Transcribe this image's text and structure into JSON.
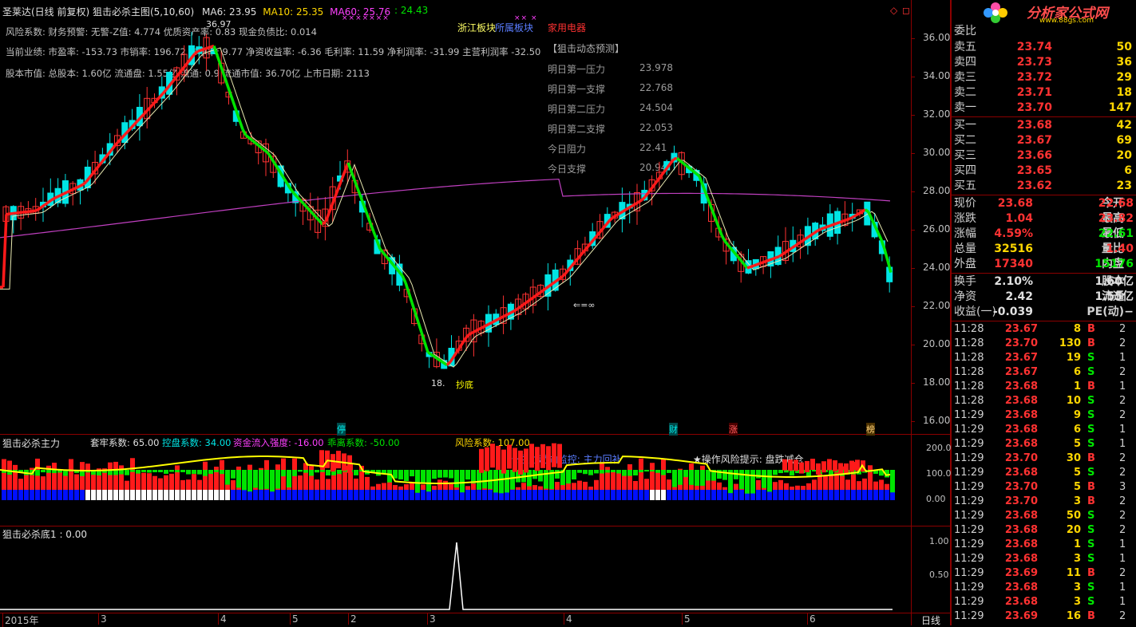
{
  "header": {
    "stock_title": "圣莱达(日线 前复权) 狙击必杀主图(5,10,60)",
    "ma6_label": "MA6: 23.95",
    "ma10_label": "MA10: 25.35",
    "ma60_label": "MA60: 25.76",
    "extra_value": ": 24.43",
    "marks": "×××××××",
    "marks2": "×× ×"
  },
  "info": {
    "line1": "风险系数: 财务预警: 无警-Z值: 4.774 优质资产率: 0.83 现金负债比: 0.014",
    "line2": "当前业绩: 市盈率: -153.73 市销率: 196.72 市净率: 9.77 净资收益率: -6.36 毛利率: 11.59 净利润率: -31.99 主营利润率 -32.50",
    "line3": "股本市值: 总股本: 1.60亿 流通盘: 1.55亿 流通: 0.9 流通市值: 36.70亿 上市日期: 2113"
  },
  "sectors": {
    "s1": "浙江板块",
    "s2": "所属板块",
    "s3": "家用电器"
  },
  "prediction": {
    "title": "【狙击动态预测】",
    "rows": [
      {
        "label": "明日第一压力",
        "value": "23.978"
      },
      {
        "label": "明日第一支撑",
        "value": "22.768"
      },
      {
        "label": "明日第二压力",
        "value": "24.504"
      },
      {
        "label": "明日第二支撑",
        "value": "22.053"
      },
      {
        "label": "今日阻力",
        "value": "22.41"
      },
      {
        "label": "今日支撑",
        "value": "20.94"
      }
    ]
  },
  "price_axis": [
    "36.00",
    "34.00",
    "32.00",
    "30.00",
    "28.00",
    "26.00",
    "24.00",
    "22.00",
    "20.00",
    "18.00",
    "16.00"
  ],
  "chart_annotations": {
    "high_label": "36.97",
    "low_label": "18.",
    "low_tag": "抄底",
    "ma_cross": "⇐=∞",
    "tag_ting": "停",
    "tag_cai": "财",
    "tag_zhang": "涨",
    "tag_bang": "榜"
  },
  "sub1": {
    "title": "狙击必杀主力",
    "jl": "套牢系数: 65.00",
    "kp": "控盘系数: 34.00",
    "zj": "资金流入强度: -16.00",
    "ql": "乖离系数: -50.00",
    "fx": "风险系数: 107.00",
    "monitor": "★主力动向监控: 主力回补",
    "tip": "★操作风险提示: 盘跌减仓",
    "axis": [
      "200.0",
      "100.0",
      "0.00"
    ]
  },
  "sub2": {
    "title": "狙击必杀底1 : 0.00",
    "axis": [
      "1.00",
      "0.50"
    ]
  },
  "time_axis": {
    "labels": [
      "2015年",
      "3",
      "4",
      "5",
      "2",
      "3",
      "4",
      "5",
      "6"
    ],
    "period": "日线"
  },
  "brand": {
    "name": "分析家公式网",
    "url": "www.88gs.com"
  },
  "order_book": {
    "header": "委比",
    "asks": [
      {
        "label": "卖五",
        "price": "23.74",
        "vol": "50"
      },
      {
        "label": "卖四",
        "price": "23.73",
        "vol": "36"
      },
      {
        "label": "卖三",
        "price": "23.72",
        "vol": "29"
      },
      {
        "label": "卖二",
        "price": "23.71",
        "vol": "18"
      },
      {
        "label": "卖一",
        "price": "23.70",
        "vol": "147"
      }
    ],
    "bids": [
      {
        "label": "买一",
        "price": "23.68",
        "vol": "42"
      },
      {
        "label": "买二",
        "price": "23.67",
        "vol": "69"
      },
      {
        "label": "买三",
        "price": "23.66",
        "vol": "20"
      },
      {
        "label": "买四",
        "price": "23.65",
        "vol": "6"
      },
      {
        "label": "买五",
        "price": "23.62",
        "vol": "23"
      }
    ]
  },
  "quote": [
    {
      "l1": "现价",
      "v1": "23.68",
      "l2": "今开",
      "v2": "22.68",
      "c1": "red",
      "c2": "red"
    },
    {
      "l1": "涨跌",
      "v1": "1.04",
      "l2": "最高",
      "v2": "23.82",
      "c1": "red",
      "c2": "red"
    },
    {
      "l1": "涨幅",
      "v1": "4.59%",
      "l2": "最低",
      "v2": "22.61",
      "c1": "red",
      "c2": "green"
    },
    {
      "l1": "总量",
      "v1": "32516",
      "l2": "量比",
      "v2": "1.40",
      "c1": "yellow",
      "c2": "red"
    },
    {
      "l1": "外盘",
      "v1": "17340",
      "l2": "内盘",
      "v2": "15176",
      "c1": "red",
      "c2": "green"
    }
  ],
  "quote2": [
    {
      "l1": "换手",
      "v1": "2.10%",
      "l2": "股本",
      "v2": "1.60亿"
    },
    {
      "l1": "净资",
      "v1": "2.42",
      "l2": "流通",
      "v2": "1.55亿"
    },
    {
      "l1": "收益(一)",
      "v1": "-0.039",
      "l2": "PE(动)",
      "v2": "−"
    }
  ],
  "ticks": [
    {
      "t": "11:28",
      "p": "23.67",
      "v": "8",
      "d": "B",
      "n": "2"
    },
    {
      "t": "11:28",
      "p": "23.70",
      "v": "130",
      "d": "B",
      "n": "2"
    },
    {
      "t": "11:28",
      "p": "23.67",
      "v": "19",
      "d": "S",
      "n": "1"
    },
    {
      "t": "11:28",
      "p": "23.67",
      "v": "6",
      "d": "S",
      "n": "2"
    },
    {
      "t": "11:28",
      "p": "23.68",
      "v": "1",
      "d": "B",
      "n": "1"
    },
    {
      "t": "11:28",
      "p": "23.68",
      "v": "10",
      "d": "S",
      "n": "2"
    },
    {
      "t": "11:29",
      "p": "23.68",
      "v": "9",
      "d": "S",
      "n": "2"
    },
    {
      "t": "11:29",
      "p": "23.68",
      "v": "6",
      "d": "S",
      "n": "1"
    },
    {
      "t": "11:29",
      "p": "23.68",
      "v": "5",
      "d": "S",
      "n": "1"
    },
    {
      "t": "11:29",
      "p": "23.70",
      "v": "30",
      "d": "B",
      "n": "2"
    },
    {
      "t": "11:29",
      "p": "23.68",
      "v": "5",
      "d": "S",
      "n": "2"
    },
    {
      "t": "11:29",
      "p": "23.70",
      "v": "5",
      "d": "B",
      "n": "3"
    },
    {
      "t": "11:29",
      "p": "23.70",
      "v": "3",
      "d": "B",
      "n": "2"
    },
    {
      "t": "11:29",
      "p": "23.68",
      "v": "50",
      "d": "S",
      "n": "2"
    },
    {
      "t": "11:29",
      "p": "23.68",
      "v": "20",
      "d": "S",
      "n": "2"
    },
    {
      "t": "11:29",
      "p": "23.68",
      "v": "1",
      "d": "S",
      "n": "1"
    },
    {
      "t": "11:29",
      "p": "23.68",
      "v": "3",
      "d": "S",
      "n": "1"
    },
    {
      "t": "11:29",
      "p": "23.69",
      "v": "11",
      "d": "B",
      "n": "2"
    },
    {
      "t": "11:29",
      "p": "23.68",
      "v": "3",
      "d": "S",
      "n": "1"
    },
    {
      "t": "11:29",
      "p": "23.68",
      "v": "3",
      "d": "S",
      "n": "1"
    },
    {
      "t": "11:29",
      "p": "23.69",
      "v": "16",
      "d": "B",
      "n": "2"
    }
  ],
  "colors": {
    "up": "#ff3232",
    "down": "#00e4e4",
    "grid": "#8b0000",
    "ma60": "#c040c0",
    "ma_fast": "#00e400"
  }
}
